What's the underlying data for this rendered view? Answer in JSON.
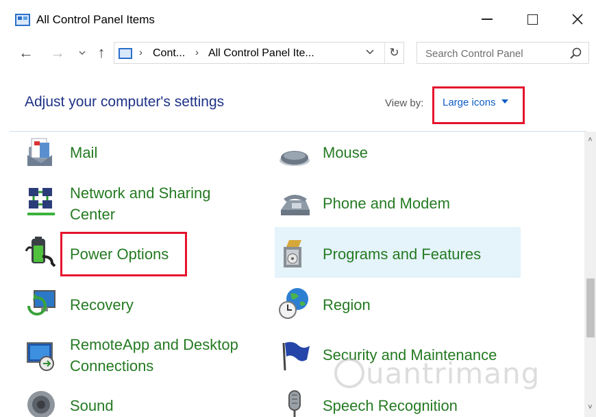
{
  "window": {
    "title": "All Control Panel Items",
    "minimize_label": "",
    "maximize_label": "",
    "close_label": "✕"
  },
  "nav": {
    "back": "←",
    "forward": "→",
    "recent": "⌄",
    "up": "↑",
    "breadcrumb_1": "Cont...",
    "breadcrumb_2": "All Control Panel Ite...",
    "separator": "›",
    "dropdown": "⌄",
    "refresh": "↻",
    "search_placeholder": "Search Control Panel"
  },
  "header": {
    "heading": "Adjust your computer's settings",
    "view_by_label": "View by:",
    "view_by_value": "Large icons"
  },
  "items": {
    "mail": "Mail",
    "mouse": "Mouse",
    "network_line1": "Network and Sharing",
    "network_line2": "Center",
    "phone_modem": "Phone and Modem",
    "power_options": "Power Options",
    "programs_features": "Programs and Features",
    "recovery": "Recovery",
    "region": "Region",
    "remoteapp_line1": "RemoteApp and Desktop",
    "remoteapp_line2": "Connections",
    "security_maintenance": "Security and Maintenance",
    "sound": "Sound",
    "speech_recognition": "Speech Recognition"
  },
  "scrollbar": {
    "up": "˄",
    "down": "˅"
  },
  "watermark": "uantrimang",
  "colors": {
    "heading": "#1e3287",
    "item_link": "#247a22",
    "highlight_box": "#e5122c",
    "hover_bg": "#e5f3fb",
    "view_by_value": "#0d5ec7"
  }
}
